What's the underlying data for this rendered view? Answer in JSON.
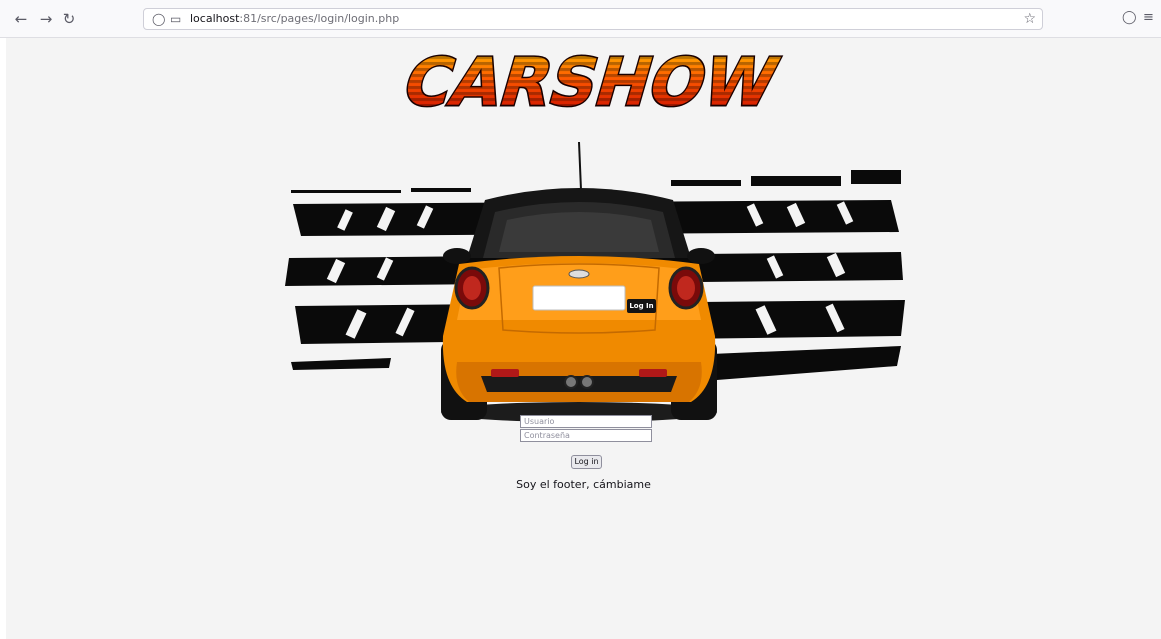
{
  "browser": {
    "url_host": "localhost",
    "url_rest": ":81/src/pages/login/login.php",
    "icons": [
      "back-icon",
      "forward-icon",
      "reload-icon",
      "shield-icon",
      "page-icon",
      "bookmark-star-icon",
      "pocket-icon",
      "menu-icon"
    ]
  },
  "page": {
    "logo_text": "CARSHOW",
    "plate_button_label": "Log In",
    "form": {
      "username_placeholder": "Usuario",
      "password_placeholder": "Contraseña",
      "submit_label": "Log in"
    },
    "footer_text": "Soy el footer, cámbiame"
  },
  "colors": {
    "background": "#f4f4f4",
    "car_orange": "#f08a00",
    "logo_red": "#e41e10",
    "logo_yellow": "#ffcc00"
  }
}
